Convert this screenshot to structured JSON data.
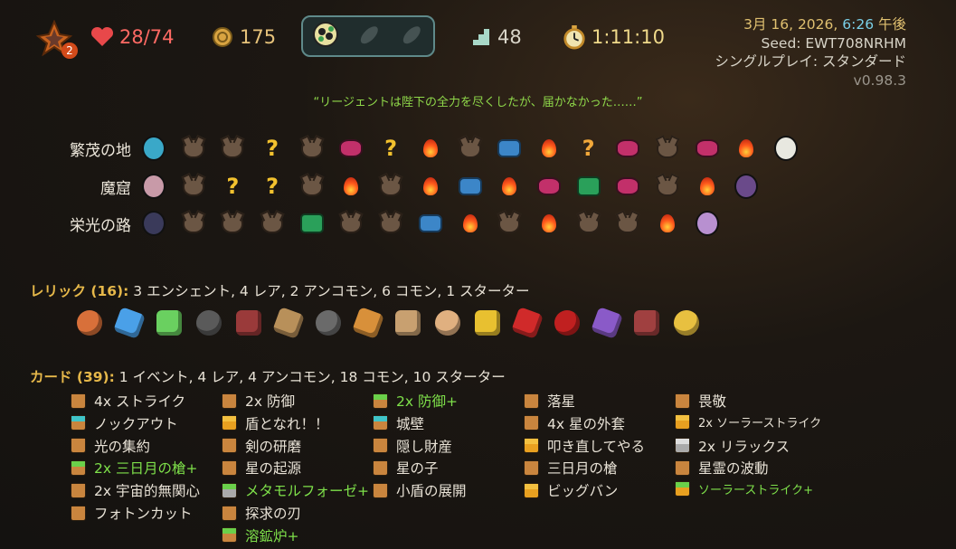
{
  "topbar": {
    "ascension_level": "2",
    "hp": "28/74",
    "gold": "175",
    "floor": "48",
    "timer": "1:11:10",
    "potions": [
      "flower-potion-icon",
      "empty-potion-slot-icon",
      "empty-potion-slot-icon"
    ]
  },
  "run_info": {
    "date_prefix": "3月 16, 2026, ",
    "time": "6:26",
    "time_suffix": " 午後",
    "seed": "Seed: EWT708NRHM",
    "mode": "シングルプレイ: スタンダード",
    "version": "v0.98.3"
  },
  "quote": "“リージェントは陛下の全力を尽くしたが、届かなかった……”",
  "acts": [
    {
      "label": "繁茂の地",
      "nodes": [
        "ancient",
        "monster",
        "monster",
        "unknown",
        "monster",
        "elite",
        "unknown",
        "rest",
        "monster",
        "shop",
        "rest",
        "unknown-elite",
        "elite",
        "monster",
        "elite",
        "rest",
        "boss"
      ]
    },
    {
      "label": "魔窟",
      "nodes": [
        "ancient",
        "monster",
        "unknown",
        "unknown",
        "monster",
        "rest",
        "monster",
        "rest",
        "shop",
        "rest",
        "elite",
        "treasure",
        "elite",
        "monster",
        "rest",
        "boss"
      ]
    },
    {
      "label": "栄光の路",
      "nodes": [
        "ancient",
        "monster",
        "monster",
        "monster",
        "treasure",
        "monster",
        "monster",
        "shop",
        "rest",
        "monster",
        "rest",
        "monster",
        "monster",
        "rest",
        "boss"
      ]
    }
  ],
  "relics": {
    "label": "レリック (16):",
    "summary": "3 エンシェント, 4 レア, 2 アンコモン, 6 コモン, 1 スターター",
    "items": [
      "ember-rock-icon",
      "blue-orb-icon",
      "green-ingot-icon",
      "kettlebell-icon",
      "helmet-icon",
      "chess-knight-icon",
      "lantern-icon",
      "croissant-icon",
      "horn-icon",
      "scroll-icon",
      "quill-icon",
      "red-book-icon",
      "potion-flask-icon",
      "purple-cushion-icon",
      "chest-icon",
      "golden-scepter-icon"
    ]
  },
  "cards": {
    "label": "カード (39):",
    "summary": "1 イベント, 4 レア, 4 アンコモン, 18 コモン, 10 スターター",
    "columns": [
      [
        {
          "text": "4x ストライク",
          "type": "strike",
          "upgraded": false
        },
        {
          "text": "ノックアウト",
          "type": "skill",
          "upgraded": false
        },
        {
          "text": "光の集約",
          "type": "strike",
          "upgraded": false
        },
        {
          "text": "2x 三日月の槍+",
          "type": "strike",
          "upgraded": true
        },
        {
          "text": "2x 宇宙的無関心",
          "type": "strike",
          "upgraded": false
        },
        {
          "text": "フォトンカット",
          "type": "strike",
          "upgraded": false
        }
      ],
      [
        {
          "text": "2x 防御",
          "type": "strike",
          "upgraded": false
        },
        {
          "text": "盾となれ！！",
          "type": "power",
          "upgraded": false
        },
        {
          "text": "剣の研磨",
          "type": "strike",
          "upgraded": false
        },
        {
          "text": "星の起源",
          "type": "strike",
          "upgraded": false
        },
        {
          "text": "メタモルフォーゼ+",
          "type": "colorless",
          "upgraded": true
        },
        {
          "text": "探求の刃",
          "type": "strike",
          "upgraded": false
        },
        {
          "text": "溶鉱炉+",
          "type": "skill",
          "upgraded": true
        }
      ],
      [
        {
          "text": "2x 防御+",
          "type": "strike",
          "upgraded": true
        },
        {
          "text": "城壁",
          "type": "skill",
          "upgraded": false
        },
        {
          "text": "隠し財産",
          "type": "strike",
          "upgraded": false
        },
        {
          "text": "星の子",
          "type": "strike",
          "upgraded": false
        },
        {
          "text": "小盾の展開",
          "type": "strike",
          "upgraded": false
        }
      ],
      [
        {
          "text": "落星",
          "type": "strike",
          "upgraded": false
        },
        {
          "text": "4x 星の外套",
          "type": "strike",
          "upgraded": false
        },
        {
          "text": "叩き直してやる",
          "type": "power",
          "upgraded": false
        },
        {
          "text": "三日月の槍",
          "type": "strike",
          "upgraded": false
        },
        {
          "text": "ビッグバン",
          "type": "power",
          "upgraded": false
        }
      ],
      [
        {
          "text": "畏敬",
          "type": "strike",
          "upgraded": false
        },
        {
          "text": "2x ソーラーストライク",
          "type": "power",
          "upgraded": false,
          "small": true
        },
        {
          "text": "2x リラックス",
          "type": "colorless",
          "upgraded": false
        },
        {
          "text": "星霊の波動",
          "type": "strike",
          "upgraded": false
        },
        {
          "text": "ソーラーストライク+",
          "type": "power",
          "upgraded": true,
          "small": true
        }
      ]
    ]
  },
  "colors": {
    "hp": "#ff6a64",
    "gold": "#e6c27a",
    "upgraded": "#7ee04a",
    "quote": "#8fd84a",
    "accent": "#e6b84a"
  }
}
